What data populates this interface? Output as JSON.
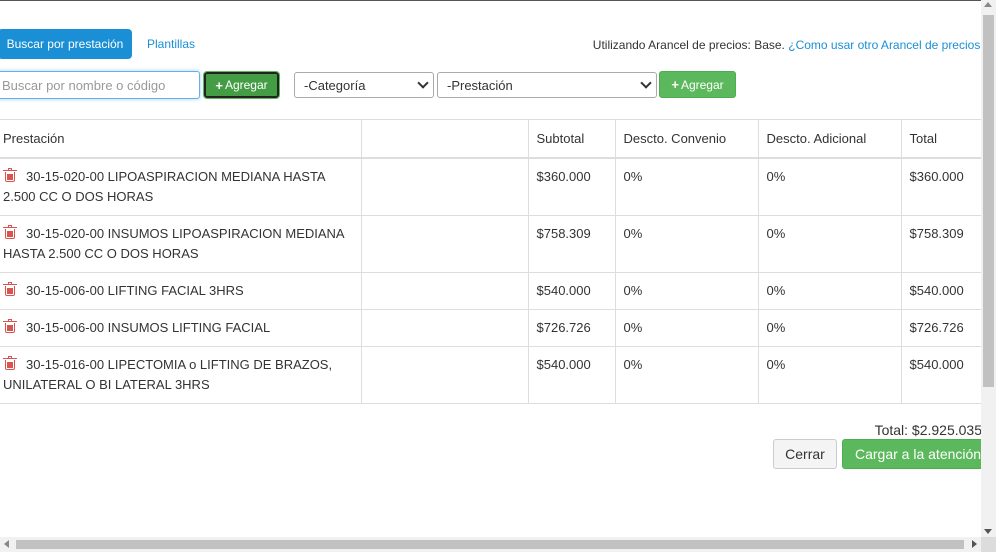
{
  "tabs": {
    "active": "Buscar por prestación",
    "secondary": "Plantillas"
  },
  "arancel": {
    "prefix": "Utilizando Arancel de precios: Base.",
    "link": "¿Como usar otro Arancel de precios?"
  },
  "search": {
    "placeholder": "Buscar por nombre o código",
    "value": ""
  },
  "add_button_label": "Agregar",
  "category_select": {
    "selected": "-Categoría"
  },
  "prestacion_select": {
    "selected": "-Prestación"
  },
  "add_button2_label": "Agregar",
  "table": {
    "headers": [
      "Prestación",
      "",
      "Subtotal",
      "Descto. Convenio",
      "Descto. Adicional",
      "Total"
    ],
    "rows": [
      {
        "name": "30-15-020-00 LIPOASPIRACION MEDIANA HASTA 2.500 CC O DOS HORAS",
        "subtotal": "$360.000",
        "convenio": "0%",
        "adicional": "0%",
        "total": "$360.000"
      },
      {
        "name": "30-15-020-00 INSUMOS LIPOASPIRACION MEDIANA HASTA 2.500 CC O DOS HORAS",
        "subtotal": "$758.309",
        "convenio": "0%",
        "adicional": "0%",
        "total": "$758.309"
      },
      {
        "name": "30-15-006-00 LIFTING FACIAL 3HRS",
        "subtotal": "$540.000",
        "convenio": "0%",
        "adicional": "0%",
        "total": "$540.000"
      },
      {
        "name": "30-15-006-00 INSUMOS LIFTING FACIAL",
        "subtotal": "$726.726",
        "convenio": "0%",
        "adicional": "0%",
        "total": "$726.726"
      },
      {
        "name": "30-15-016-00 LIPECTOMIA o LIFTING DE BRAZOS, UNILATERAL O BI LATERAL 3HRS",
        "subtotal": "$540.000",
        "convenio": "0%",
        "adicional": "0%",
        "total": "$540.000"
      }
    ]
  },
  "footer": {
    "total": "Total: $2.925.035",
    "close_label": "Cerrar",
    "submit_label": "Cargar a la atención"
  },
  "colors": {
    "primary": "#1a8fd6",
    "success": "#5cb85c",
    "danger": "#d9534f"
  }
}
